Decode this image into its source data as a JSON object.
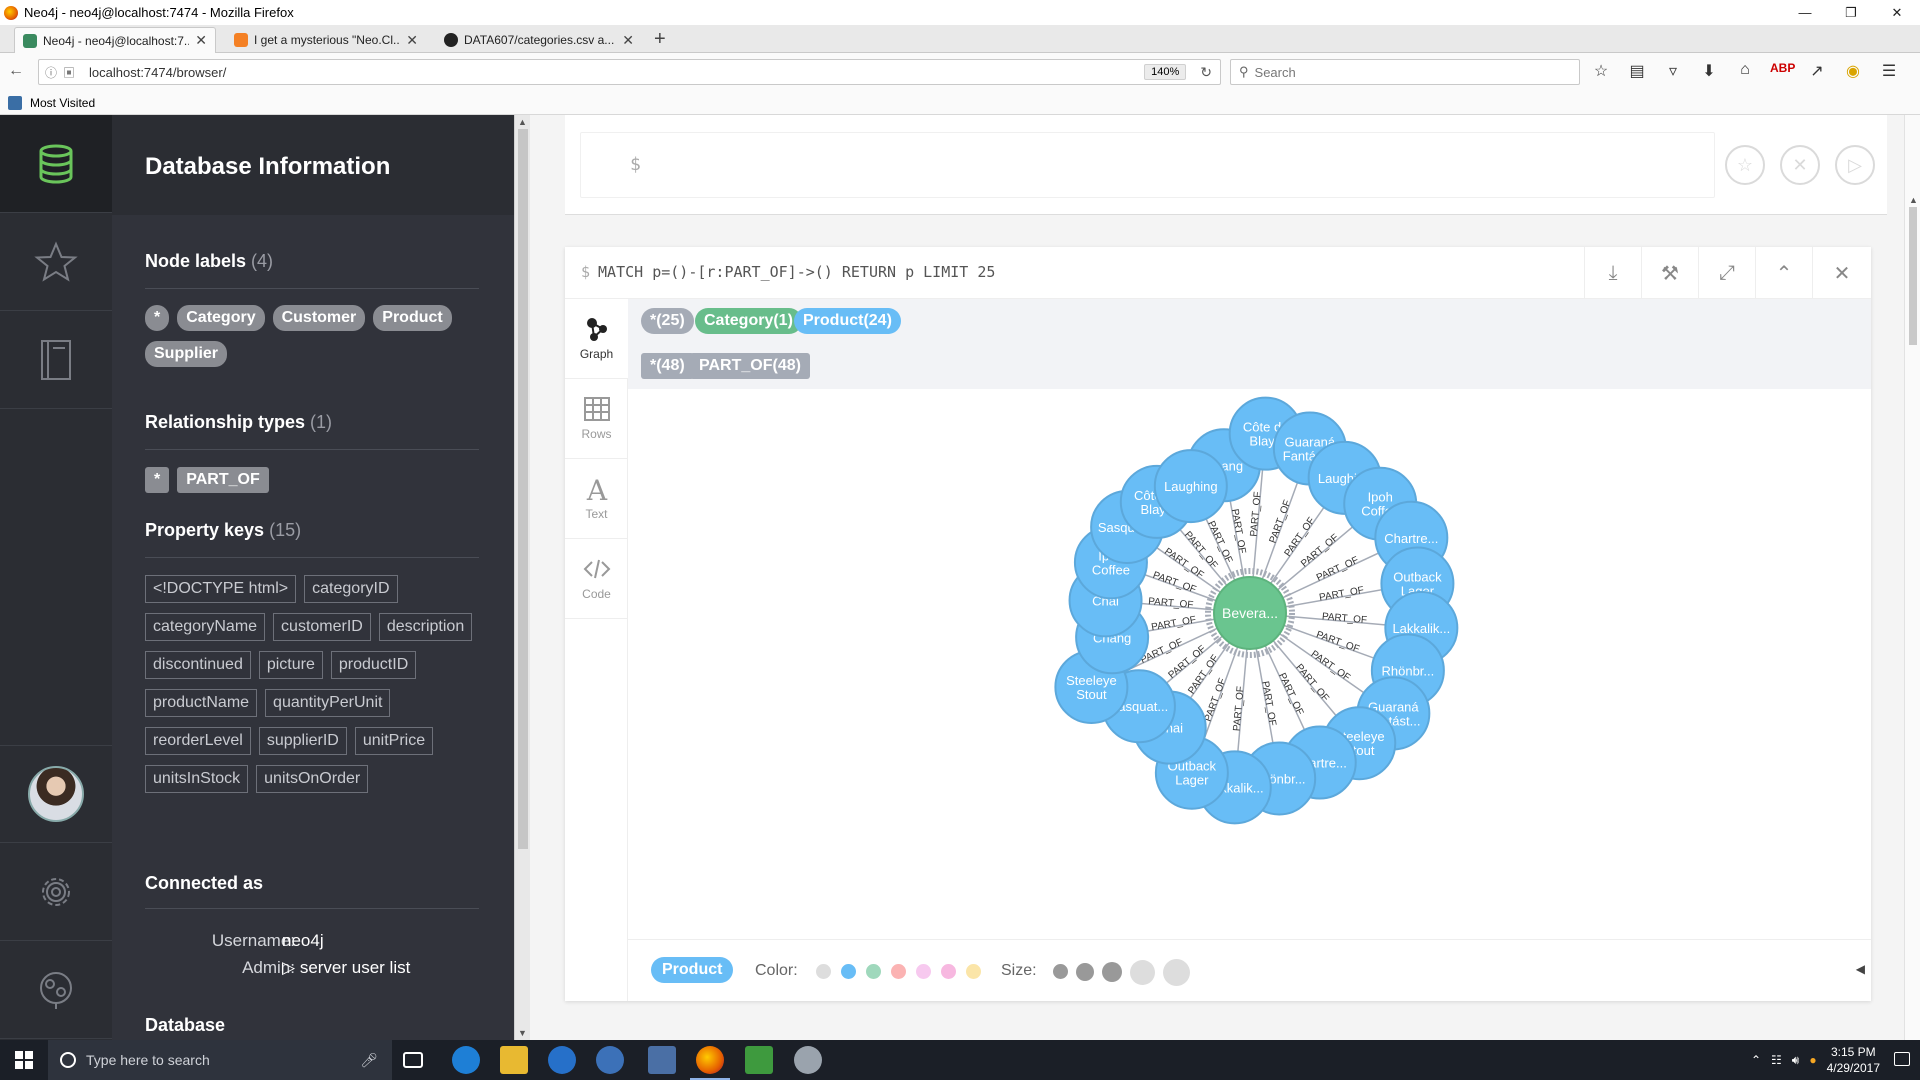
{
  "window": {
    "title": "Neo4j - neo4j@localhost:7474 - Mozilla Firefox"
  },
  "tabs": [
    {
      "label": "Neo4j - neo4j@localhost:7...",
      "active": true,
      "icon": "neo4j-favicon-icon"
    },
    {
      "label": "I get a mysterious \"Neo.Cl...",
      "active": false,
      "icon": "stackoverflow-favicon-icon"
    },
    {
      "label": "DATA607/categories.csv a...",
      "active": false,
      "icon": "github-favicon-icon"
    }
  ],
  "navbar": {
    "url": "localhost:7474/browser/",
    "zoom": "140%",
    "search_placeholder": "Search"
  },
  "bookmarks": {
    "most_visited": "Most Visited"
  },
  "drawer": {
    "title": "Database Information",
    "node_labels_title": "Node labels",
    "node_labels_count": "(4)",
    "node_labels": [
      "*",
      "Category",
      "Customer",
      "Product",
      "Supplier"
    ],
    "rel_types_title": "Relationship types",
    "rel_types_count": "(1)",
    "rel_types": [
      "*",
      "PART_OF"
    ],
    "prop_keys_title": "Property keys",
    "prop_keys_count": "(15)",
    "prop_keys": [
      "<!DOCTYPE html>",
      "categoryID",
      "categoryName",
      "customerID",
      "description",
      "discontinued",
      "picture",
      "productID",
      "productName",
      "quantityPerUnit",
      "reorderLevel",
      "supplierID",
      "unitPrice",
      "unitsInStock",
      "unitsOnOrder"
    ],
    "connected_title": "Connected as",
    "username_label": "Username:",
    "username_value": "neo4j",
    "admin_label": "Admin:",
    "admin_value": "server user list",
    "database_title": "Database"
  },
  "editor": {
    "prompt": "$"
  },
  "frame": {
    "prompt": "$",
    "query": "MATCH p=()-[r:PART_OF]->() RETURN p LIMIT 25",
    "view_tabs": [
      "Graph",
      "Rows",
      "Text",
      "Code"
    ],
    "legend_nodes": [
      {
        "label": "*(25)",
        "color": "#a5abb6"
      },
      {
        "label": "Category(1)",
        "color": "#68bd8b"
      },
      {
        "label": "Product(24)",
        "color": "#68bdf6"
      }
    ],
    "legend_rels": [
      {
        "label": "*(48)",
        "color": "#a5abb6"
      },
      {
        "label": "PART_OF(48)",
        "color": "#a5abb6"
      }
    ],
    "inspector": {
      "chip": "Product",
      "color_label": "Color:",
      "size_label": "Size:",
      "colors": [
        "#dddddd",
        "#68bdf6",
        "#9fd8bc",
        "#fbb3b3",
        "#f7c9ef",
        "#f7b8e0",
        "#fbe5a8"
      ]
    }
  },
  "graph": {
    "center": {
      "label": "Bevera...",
      "color": "#6ac58f"
    },
    "edge_label": "PART_OF",
    "products": [
      "Chang",
      "Côte de|Blaye",
      "Guaraná|Fantást...",
      "Laughing",
      "Ipoh|Coffee",
      "Chartre...",
      "Outback|Lager",
      "Lakkalik...",
      "Rhönbr...",
      "Guaraná|Fantást...",
      "Steeleye|Stout",
      "Chartre...",
      "Rhönbr...",
      "Lakkalik...",
      "Outback|Lager",
      "Chai",
      "Sasquat...",
      "Steeleye|Stout",
      "Chang",
      "Chai",
      "Ipoh|Coffee",
      "Sasquat...",
      "Côte de|Blaye",
      "Laughing"
    ],
    "node_color": "#68bdf6"
  },
  "taskbar": {
    "search_placeholder": "Type here to search",
    "time": "3:15 PM",
    "date": "4/29/2017"
  }
}
